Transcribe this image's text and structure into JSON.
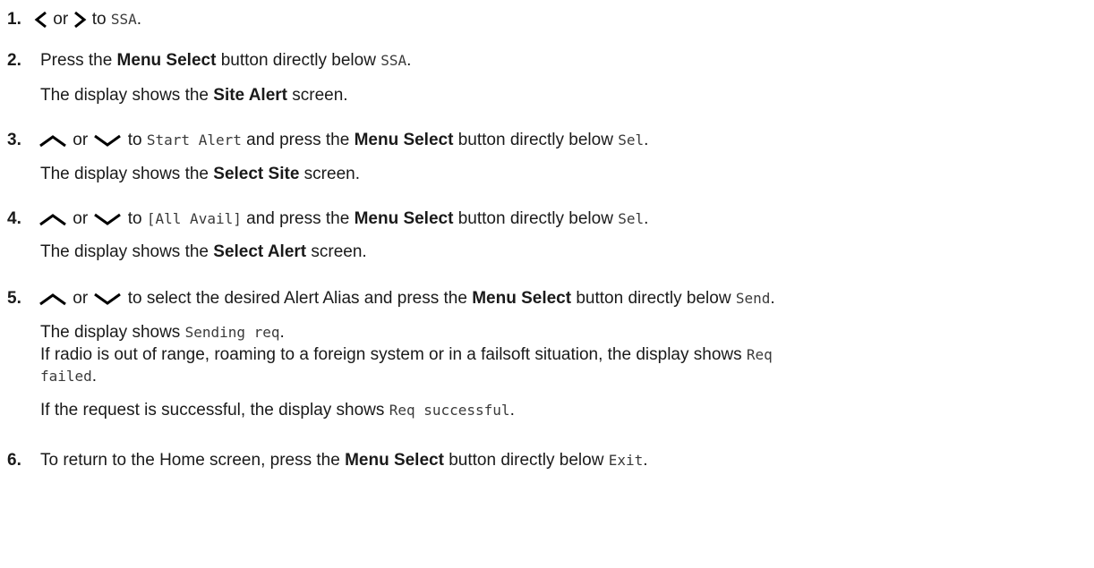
{
  "steps": [
    {
      "num": "1.",
      "or": "or",
      "to": "to",
      "code": "SSA",
      "end": "."
    },
    {
      "num": "2.",
      "pre": "Press the",
      "bold": "Menu Select",
      "mid": "button directly below",
      "code": "SSA",
      "end": ".",
      "result_pre": "The display shows the",
      "result_bold": "Site Alert",
      "result_post": "screen."
    },
    {
      "num": "3.",
      "or": "or",
      "to": "to",
      "code": "Start Alert",
      "mid1": "and press the",
      "bold": "Menu Select",
      "mid2": "button directly below",
      "code2": "Sel",
      "end": ".",
      "result_pre": "The display shows the",
      "result_bold": "Select Site",
      "result_post": "screen."
    },
    {
      "num": "4.",
      "or": "or",
      "to": "to",
      "code": "[All Avail]",
      "mid1": "and press the",
      "bold": "Menu Select",
      "mid2": "button directly below",
      "code2": "Sel",
      "end": ".",
      "result_pre": "The display shows the",
      "result_bold": "Select Alert",
      "result_post": "screen."
    },
    {
      "num": "5.",
      "or": "or",
      "to": "to select the desired Alert Alias and press the",
      "bold": "Menu Select",
      "mid2": "button directly below",
      "code2": "Send",
      "end": ".",
      "result1_pre": "The display shows",
      "result1_code": "Sending req",
      "result1_end": ".",
      "result2_pre": "If radio is out of range, roaming to a foreign system or in a failsoft situation, the display shows",
      "result2_code_a": "Req",
      "result2_code_b": "failed",
      "result2_end": ".",
      "result3_pre": "If the request is successful, the display shows",
      "result3_code": "Req successful",
      "result3_end": "."
    },
    {
      "num": "6.",
      "pre": "To return to the Home screen, press the",
      "bold": "Menu Select",
      "mid": "button directly below",
      "code": "Exit",
      "end": "."
    }
  ],
  "icons": {
    "left": "chevron-left-icon",
    "right": "chevron-right-icon",
    "up": "chevron-up-icon",
    "down": "chevron-down-icon"
  }
}
